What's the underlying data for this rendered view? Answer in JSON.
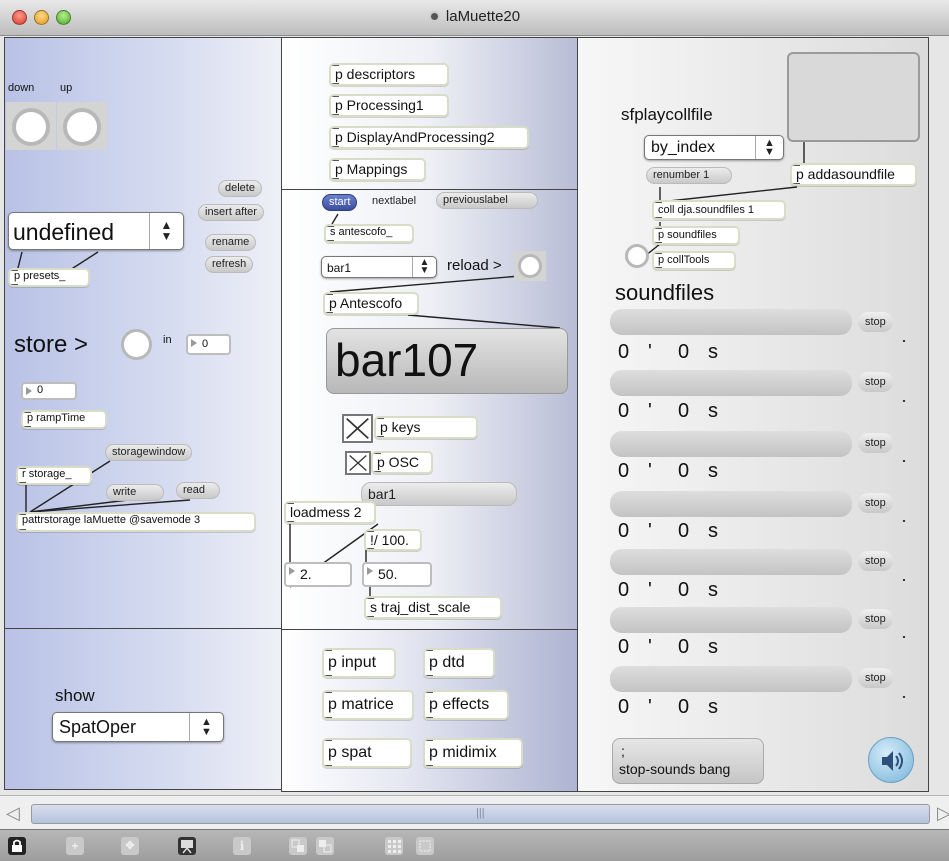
{
  "window": {
    "title": "laMuette20"
  },
  "left": {
    "down_label": "down",
    "up_label": "up",
    "messages": {
      "delete": "delete",
      "insert_after": "insert after",
      "rename": "rename",
      "refresh": "refresh"
    },
    "preset_menu_value": "undefined",
    "presets_obj": "p presets_",
    "store_label": "store >",
    "in_label": "in",
    "store_number": "0",
    "ramp_number": "0",
    "ramptime_obj": "p rampTime",
    "storagewindow_msg": "storagewindow",
    "r_storage_obj": "r storage_",
    "write_msg": "write",
    "read_msg": "read",
    "pattrstorage_obj": "pattrstorage laMuette @savemode 3",
    "show_label": "show",
    "show_menu_value": "SpatOper"
  },
  "middle": {
    "subpatches": [
      "p descriptors",
      "p Processing1",
      "p DisplayAndProcessing2",
      "p Mappings"
    ],
    "start_msg": "start",
    "nextlabel_msg": "nextlabel",
    "previouslabel_msg": "previouslabel",
    "s_antescofo_obj": "s antescofo_",
    "bar_menu_value": "bar1",
    "reload_label": "reload >",
    "antescofo_obj": "p Antescofo",
    "bar_display": "bar107",
    "keys_obj": "p keys",
    "osc_obj": "p OSC",
    "bar1_msg": "bar1",
    "loadmess_obj": "loadmess 2",
    "div_obj": "!/ 100.",
    "float_left": "2.",
    "float_right": "50.",
    "traj_obj": "s traj_dist_scale",
    "bottom_buttons": [
      "p input",
      "p dtd",
      "p matrice",
      "p effects",
      "p spat",
      "p midimix"
    ]
  },
  "right": {
    "sfplay_label": "sfplaycollfile",
    "by_index_value": "by_index",
    "renumber_msg": "renumber 1",
    "addasoundfile_obj": "p addasoundfile",
    "coll_obj": "coll dja.soundfiles 1",
    "soundfiles_obj": "p soundfiles",
    "colltools_obj": "p collTools",
    "soundfiles_title": "soundfiles",
    "stop_label": "stop",
    "readouts": [
      {
        "minutes": "0",
        "sep": "'",
        "seconds": "0",
        "unit": "s"
      },
      {
        "minutes": "0",
        "sep": "'",
        "seconds": "0",
        "unit": "s"
      },
      {
        "minutes": "0",
        "sep": "'",
        "seconds": "0",
        "unit": "s"
      },
      {
        "minutes": "0",
        "sep": "'",
        "seconds": "0",
        "unit": "s"
      },
      {
        "minutes": "0",
        "sep": "'",
        "seconds": "0",
        "unit": "s"
      },
      {
        "minutes": "0",
        "sep": "'",
        "seconds": "0",
        "unit": "s"
      },
      {
        "minutes": "0",
        "sep": "'",
        "seconds": "0",
        "unit": "s"
      }
    ],
    "stop_sounds_line1": ";",
    "stop_sounds_line2": "stop-sounds bang"
  },
  "icons": {
    "toolbar": [
      "lock-icon",
      "new-object-icon",
      "move-icon",
      "presentation-icon",
      "inspector-icon",
      "encapsulate-icon",
      "de-encapsulate-icon",
      "grid-icon",
      "snap-icon"
    ],
    "speaker": "speaker-icon"
  },
  "colors": {
    "accent_start": "#4a5ea8",
    "panel_gradient_a": "#c7cde8",
    "panel_gradient_b": "#eef0f7"
  }
}
